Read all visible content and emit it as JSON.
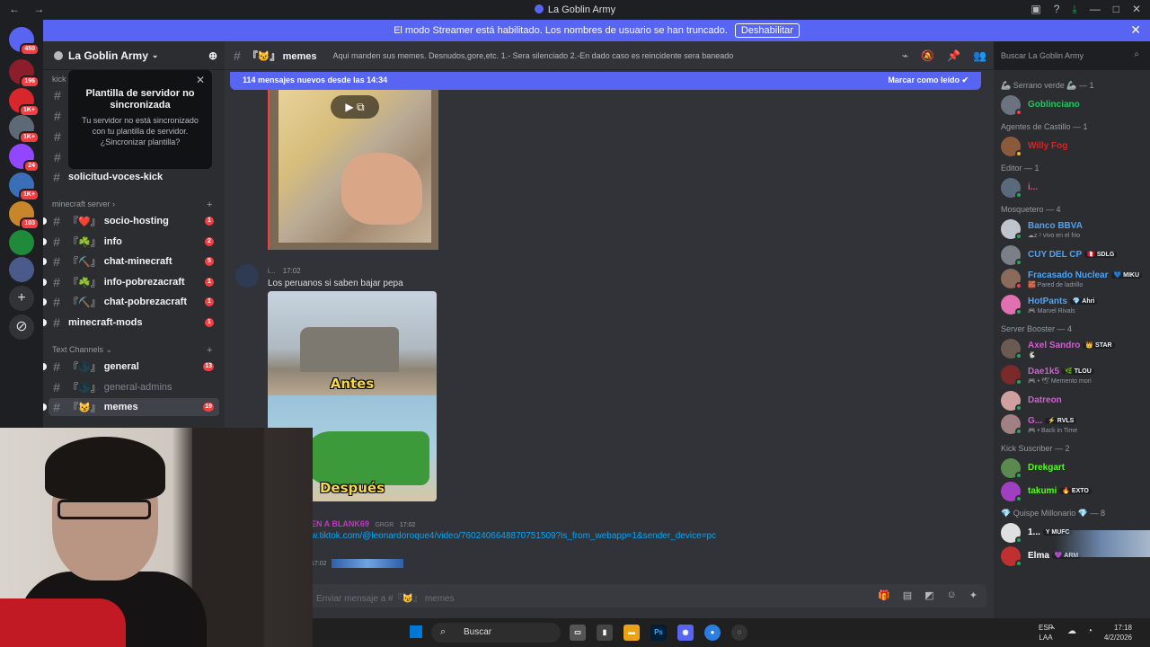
{
  "window": {
    "title": "La Goblin Army",
    "nav_back": "←",
    "nav_forward": "→"
  },
  "banner": {
    "text": "El modo Streamer está habilitado. Los nombres de usuario se han truncado.",
    "button": "Deshabilitar"
  },
  "rail": {
    "servers": [
      {
        "badge": "450",
        "color": "#5865f2"
      },
      {
        "badge": "196",
        "color": "#8b1e2a"
      },
      {
        "badge": "1K+",
        "color": "#d9262a"
      },
      {
        "badge": "1K+",
        "color": "#5d6a75"
      },
      {
        "badge": "24",
        "color": "#9146ff"
      },
      {
        "badge": "1K+",
        "color": "#3a6fb8"
      },
      {
        "badge": "103",
        "color": "#c8862a"
      },
      {
        "badge": "",
        "color": "#1f8a3a"
      },
      {
        "badge": "",
        "color": "#4a5a8a"
      }
    ]
  },
  "server": {
    "name": "La Goblin Army",
    "popup": {
      "title": "Plantilla de servidor no sincronizada",
      "description": "Tu servidor no está sincronizado con tu plantilla de servidor. ¿Sincronizar plantilla?"
    },
    "kick_label": "kick",
    "channels_top": [
      {
        "name": "solicitud-voces-kick",
        "emoji": "",
        "count": ""
      }
    ],
    "category_minecraft": "minecraft server",
    "channels_minecraft": [
      {
        "emoji": "『❤️』",
        "name": "socio-hosting",
        "count": "1"
      },
      {
        "emoji": "『☘️』",
        "name": "info",
        "count": "2"
      },
      {
        "emoji": "『⛏️』",
        "name": "chat-minecraft",
        "count": "5"
      },
      {
        "emoji": "『☘️』",
        "name": "info-pobrezacraft",
        "count": "1"
      },
      {
        "emoji": "『⛏️』",
        "name": "chat-pobrezacraft",
        "count": "1"
      },
      {
        "emoji": "",
        "name": "minecraft-mods",
        "count": "1"
      }
    ],
    "category_text": "Text Channels",
    "channels_text": [
      {
        "emoji": "『🌑』",
        "name": "general",
        "count": "13"
      },
      {
        "emoji": "『🌑』",
        "name": "general-admins",
        "count": ""
      },
      {
        "emoji": "『😼』",
        "name": "memes",
        "count": "19"
      }
    ]
  },
  "channel": {
    "name": "memes",
    "emoji": "『😼』",
    "topic": "Aqui manden sus memes. Desnudos,gore,etc. 1.- Sera silenciado 2.-En dado caso es reincidente sera baneado"
  },
  "search": {
    "placeholder": "Buscar La Goblin Army"
  },
  "new_messages": {
    "text": "114 mensajes nuevos desde las 14:34",
    "mark": "Marcar como leído"
  },
  "messages": [
    {
      "user": "i...",
      "time": "17:02",
      "text": "Los peruanos si saben bajar pepa",
      "caption_top": "Antes",
      "caption_bottom": "Después"
    },
    {
      "user": "EN A BLANK69",
      "tag": "GRGR",
      "time": "17:02",
      "link": "w.tiktok.com/@leonardoroque4/video/7602406648870751509?is_from_webapp=1&sender_device=pc"
    },
    {
      "time": "17:02"
    }
  ],
  "composer": {
    "placeholder": "Enviar mensaje a #『😼』 memes"
  },
  "members": [
    {
      "type": "role",
      "label": "🦾 Serrano verde 🦾 — 1"
    },
    {
      "type": "member",
      "name": "Goblinciano",
      "color": "#23c55e",
      "status": "#f23f43",
      "avatar": "#6b7280"
    },
    {
      "type": "role",
      "label": "Agentes de Castillo — 1"
    },
    {
      "type": "member",
      "name": "Willy Fog",
      "color": "#e02020",
      "status": "#f0b232",
      "avatar": "#8a5a3a"
    },
    {
      "type": "role",
      "label": "Editor — 1"
    },
    {
      "type": "member",
      "name": "i...",
      "color": "#e0507a",
      "status": "#23a55a",
      "avatar": "#5a6a7a"
    },
    {
      "type": "role",
      "label": "Mosquetero — 4"
    },
    {
      "type": "member",
      "name": "Banco BBVA",
      "sub": "☁z ᶻ vivo en el frio",
      "color": "#4ea3f5",
      "status": "#23a55a",
      "avatar": "#c0c4cc"
    },
    {
      "type": "member",
      "name": "CUY DEL CP",
      "pill": "🇵🇪 SDLG",
      "color": "#4ea3f5",
      "status": "#23a55a",
      "avatar": "#7a7f88"
    },
    {
      "type": "member",
      "name": "Fracasado Nuclear",
      "pill": "💙 MIKU",
      "sub": "🧱 Pared de ladrillo",
      "color": "#4ea3f5",
      "status": "#f23f43",
      "avatar": "#8a6a5a"
    },
    {
      "type": "member",
      "name": "HotPants",
      "pill": "💎 Ahri",
      "sub": "🎮 Marvel Rivals",
      "color": "#4ea3f5",
      "status": "#23a55a",
      "avatar": "#e070b0"
    },
    {
      "type": "role",
      "label": "Server Booster — 4"
    },
    {
      "type": "member",
      "name": "Axel Sandro",
      "pill": "👑 STAR",
      "sub": "🐇",
      "color": "#d55bd5",
      "status": "#23a55a",
      "avatar": "#6a5a50"
    },
    {
      "type": "member",
      "name": "Dae1k5",
      "pill": "🌿 TLOU",
      "sub": "🎮 • 🕊 Memento mori",
      "color": "#d55bd5",
      "status": "#23a55a",
      "avatar": "#7a2a2a"
    },
    {
      "type": "member",
      "name": "Datreon",
      "color": "#d55bd5",
      "status": "#23a55a",
      "avatar": "#d0a0a0"
    },
    {
      "type": "member",
      "name": "G...",
      "pill": "⚡ RVLS",
      "sub": "🎮 • Back in Time",
      "color": "#d55bd5",
      "status": "#23a55a",
      "avatar": "#a08080"
    },
    {
      "type": "role",
      "label": "Kick Suscriber — 2"
    },
    {
      "type": "member",
      "name": "Drekgart",
      "color": "#53fc18",
      "status": "#23a55a",
      "avatar": "#5a8a50"
    },
    {
      "type": "member",
      "name": "takumi",
      "pill": "🔥 EXTO",
      "color": "#53fc18",
      "status": "#23a55a",
      "avatar": "#a040c0"
    },
    {
      "type": "role",
      "label": "💎 Quispe Millonario 💎 — 8"
    },
    {
      "type": "member",
      "name": "1...",
      "pill": "Y MUFC",
      "color": "#ffffff",
      "status": "#23a55a",
      "avatar": "#e0e0e0"
    },
    {
      "type": "member",
      "name": "Elma",
      "pill": "💜 ARM",
      "color": "#ffffff",
      "status": "#23a55a",
      "avatar": "#c03030"
    }
  ],
  "taskbar": {
    "search": "Buscar",
    "lang_top": "ESP",
    "lang_bottom": "LAA",
    "time": "17:18",
    "date": "4/2/2026"
  }
}
